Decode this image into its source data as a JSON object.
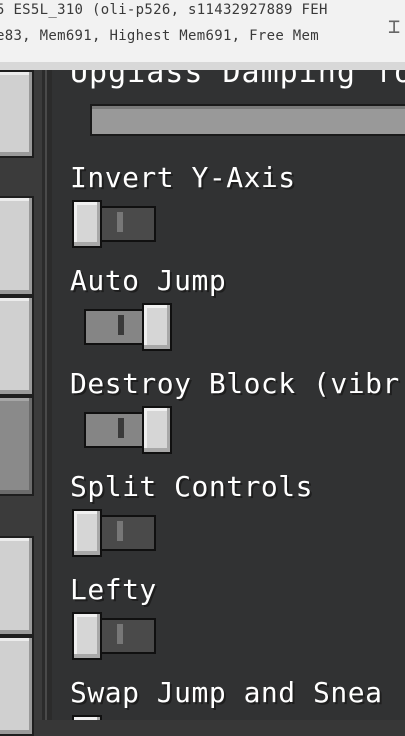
{
  "debug_overlay": {
    "line1": "5 ES5L_310 (oli-p526, s11432927889 FEH",
    "line2": "e83, Mem691, Highest Mem691, Free Mem",
    "close_glyph": "⌶"
  },
  "settings": {
    "cut_off_heading": "Upgiass Damping fo",
    "items": [
      {
        "label": "Invert Y-Axis",
        "state": "off"
      },
      {
        "label": "Auto Jump",
        "state": "on"
      },
      {
        "label": "Destroy Block (vibr",
        "state": "on"
      },
      {
        "label": "Split Controls",
        "state": "off"
      },
      {
        "label": "Lefty",
        "state": "off"
      },
      {
        "label": "Swap Jump and Snea",
        "state": "off"
      }
    ]
  },
  "colors": {
    "panel": "#313233",
    "toggle_on": "#858585",
    "toggle_off": "#4a4a4a",
    "text": "#ffffff"
  }
}
